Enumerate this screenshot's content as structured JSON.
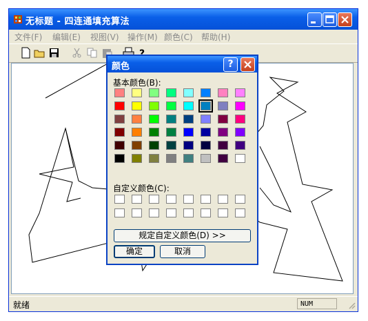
{
  "window": {
    "title": "无标题 - 四连通填充算法"
  },
  "menu": [
    "文件(F)",
    "编辑(E)",
    "视图(V)",
    "操作(M)",
    "颜色(C)",
    "帮助(H)"
  ],
  "status": {
    "text": "就绪",
    "num": "NUM"
  },
  "dialog": {
    "title": "颜色",
    "help_label": "?",
    "basic_label": "基本颜色(B):",
    "custom_label": "自定义颜色(C):",
    "define_button": "规定自定义颜色(D) >>",
    "ok_button": "确定",
    "cancel_button": "取消",
    "basic_colors": [
      [
        "#ff8080",
        "#ffff80",
        "#80ff80",
        "#00ff80",
        "#80ffff",
        "#0080ff",
        "#ff80c0",
        "#ff80ff"
      ],
      [
        "#ff0000",
        "#ffff00",
        "#80ff00",
        "#00ff40",
        "#00ffff",
        "#0080c0",
        "#8080c0",
        "#ff00ff"
      ],
      [
        "#804040",
        "#ff8040",
        "#00ff00",
        "#008080",
        "#004080",
        "#8080ff",
        "#800040",
        "#ff0080"
      ],
      [
        "#800000",
        "#ff8000",
        "#008000",
        "#008040",
        "#0000ff",
        "#0000a0",
        "#800080",
        "#8000ff"
      ],
      [
        "#400000",
        "#804000",
        "#004000",
        "#004040",
        "#000080",
        "#000040",
        "#400040",
        "#400080"
      ],
      [
        "#000000",
        "#808000",
        "#808040",
        "#808080",
        "#408080",
        "#c0c0c0",
        "#400040",
        "#ffffff"
      ]
    ],
    "selected": "#0080c0"
  }
}
